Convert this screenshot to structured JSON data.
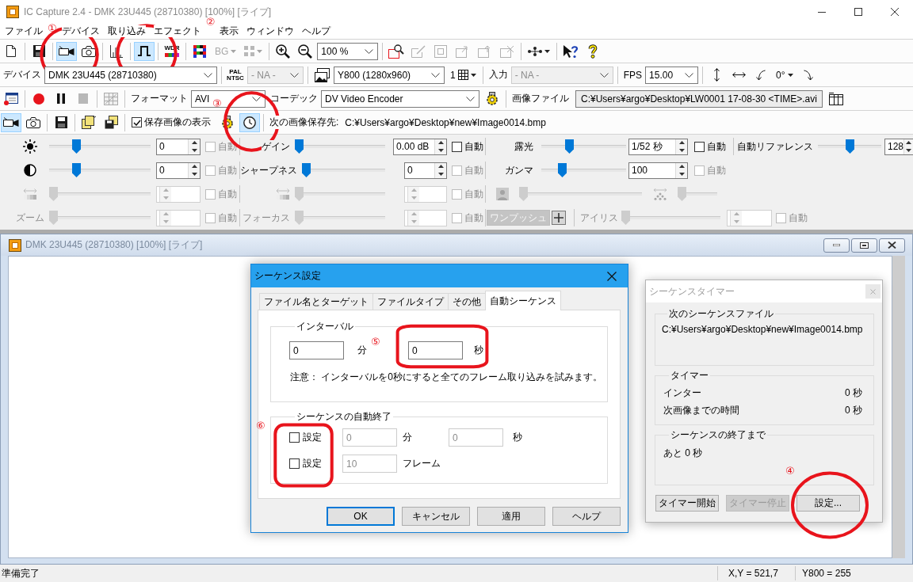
{
  "window": {
    "title": "IC Capture 2.4 - DMK 23U445 (28710380) [100%] [ライブ]"
  },
  "menu": [
    "ファイル",
    "デバイス",
    "取り込み",
    "エフェクト",
    "表示",
    "ウィンドウ",
    "ヘルプ"
  ],
  "toolbars": [
    [
      {
        "kind": "button",
        "selected": false,
        "disabled": false
      },
      {
        "kind": "separator"
      },
      {
        "kind": "button",
        "selected": false,
        "disabled": false
      },
      {
        "kind": "separator"
      },
      {
        "kind": "button",
        "selected": true,
        "disabled": false
      },
      {
        "kind": "button",
        "selected": false,
        "disabled": false
      },
      {
        "kind": "separator"
      },
      {
        "kind": "button",
        "selected": false,
        "disabled": false
      },
      {
        "kind": "separator"
      },
      {
        "kind": "button",
        "selected": true,
        "disabled": false
      },
      {
        "kind": "separator"
      },
      {
        "kind": "button",
        "text": "WDR",
        "selected": false,
        "disabled": false
      },
      {
        "kind": "separator"
      },
      {
        "kind": "button",
        "selected": false,
        "disabled": false
      },
      {
        "kind": "menu-button",
        "text": "BG",
        "disabled": true
      },
      {
        "kind": "menu-button",
        "disabled": true
      },
      {
        "kind": "separator"
      },
      {
        "kind": "button",
        "selected": false,
        "disabled": false
      },
      {
        "kind": "button",
        "selected": false,
        "disabled": false
      },
      {
        "kind": "combo",
        "value": "100 %",
        "disabled": false
      },
      {
        "kind": "separator"
      },
      {
        "kind": "button",
        "selected": false,
        "disabled": false
      },
      {
        "kind": "button",
        "selected": false,
        "disabled": true
      },
      {
        "kind": "button",
        "selected": false,
        "disabled": true
      },
      {
        "kind": "button",
        "selected": false,
        "disabled": true
      },
      {
        "kind": "button",
        "selected": false,
        "disabled": true
      },
      {
        "kind": "button",
        "selected": false,
        "disabled": true
      },
      {
        "kind": "separator"
      },
      {
        "kind": "menu-button",
        "disabled": false
      },
      {
        "kind": "separator"
      },
      {
        "kind": "button",
        "selected": false,
        "disabled": false
      },
      {
        "kind": "button",
        "selected": false,
        "disabled": false
      }
    ],
    [
      {
        "kind": "label",
        "text": "デバイス"
      },
      {
        "kind": "combo",
        "value": "DMK 23U445 (28710380)",
        "disabled": false
      },
      {
        "kind": "separator"
      },
      {
        "kind": "button",
        "text": "PAL NTSC",
        "selected": false,
        "disabled": false
      },
      {
        "kind": "combo",
        "value": "- NA -",
        "disabled": true
      },
      {
        "kind": "separator"
      },
      {
        "kind": "button",
        "selected": false,
        "disabled": false
      },
      {
        "kind": "combo",
        "value": "Y800 (1280x960)",
        "disabled": false
      },
      {
        "kind": "menu-button",
        "text": "1",
        "disabled": false
      },
      {
        "kind": "separator"
      },
      {
        "kind": "label",
        "text": "入力"
      },
      {
        "kind": "combo",
        "value": "- NA -",
        "disabled": true
      },
      {
        "kind": "separator"
      },
      {
        "kind": "label",
        "text": "FPS"
      },
      {
        "kind": "combo",
        "value": "15.00",
        "disabled": false
      },
      {
        "kind": "separator"
      },
      {
        "kind": "button",
        "selected": false,
        "disabled": false
      },
      {
        "kind": "button",
        "selected": false,
        "disabled": false
      },
      {
        "kind": "button",
        "selected": false,
        "disabled": false
      },
      {
        "kind": "menu-button",
        "text": "0°",
        "disabled": false
      },
      {
        "kind": "button",
        "selected": false,
        "disabled": false
      }
    ],
    [
      {
        "kind": "button",
        "selected": false,
        "disabled": false
      },
      {
        "kind": "separator"
      },
      {
        "kind": "button",
        "selected": false,
        "disabled": false
      },
      {
        "kind": "button",
        "selected": false,
        "disabled": false
      },
      {
        "kind": "button",
        "selected": false,
        "disabled": true
      },
      {
        "kind": "separator"
      },
      {
        "kind": "button",
        "selected": false,
        "disabled": true
      },
      {
        "kind": "separator"
      },
      {
        "kind": "label",
        "text": "フォーマット"
      },
      {
        "kind": "combo",
        "value": "AVI",
        "disabled": false
      },
      {
        "kind": "label",
        "text": "コーデック"
      },
      {
        "kind": "combo",
        "value": "DV Video Encoder",
        "disabled": false
      },
      {
        "kind": "button",
        "selected": false,
        "disabled": false
      },
      {
        "kind": "separator"
      },
      {
        "kind": "label",
        "text": "画像ファイル"
      },
      {
        "kind": "field",
        "value": "C:¥Users¥argo¥Desktop¥LW0001 17-08-30 <TIME>.avi"
      },
      {
        "kind": "button",
        "selected": false,
        "disabled": false
      }
    ],
    [
      {
        "kind": "button",
        "selected": true,
        "disabled": false
      },
      {
        "kind": "button",
        "selected": false,
        "disabled": false
      },
      {
        "kind": "separator"
      },
      {
        "kind": "button",
        "selected": false,
        "disabled": false
      },
      {
        "kind": "separator"
      },
      {
        "kind": "button",
        "selected": false,
        "disabled": false
      },
      {
        "kind": "button",
        "selected": false,
        "disabled": false
      },
      {
        "kind": "separator"
      },
      {
        "kind": "checkbox",
        "label": "保存画像の表示",
        "checked": true
      },
      {
        "kind": "button",
        "selected": false,
        "disabled": false
      },
      {
        "kind": "button",
        "selected": true,
        "disabled": false
      },
      {
        "kind": "separator"
      },
      {
        "kind": "label",
        "text": "次の画像保存先:"
      },
      {
        "kind": "text",
        "text": "C:¥Users¥argo¥Desktop¥new¥Image0014.bmp"
      }
    ]
  ],
  "properties": [
    [
      {
        "kind": "slider",
        "level": 0.25,
        "disabled": false,
        "value": "0",
        "auto": {
          "label": "自動",
          "checked": false,
          "disabled": true
        }
      },
      {
        "kind": "slider",
        "label": "ゲイン",
        "level": 0,
        "disabled": false,
        "value": "0.00 dB",
        "auto": {
          "label": "自動",
          "checked": false,
          "disabled": false
        }
      },
      {
        "kind": "slider",
        "label": "露光",
        "level": 0.31,
        "disabled": false,
        "value": "1/52 秒",
        "auto": {
          "label": "自動",
          "checked": false,
          "disabled": false
        }
      },
      {
        "kind": "slider",
        "label": "自動リファレンス",
        "level": 0.5,
        "disabled": false,
        "value": "128"
      }
    ],
    [
      {
        "kind": "slider",
        "level": 0.25,
        "disabled": false,
        "value": "0",
        "auto": {
          "label": "自動",
          "checked": false,
          "disabled": true
        }
      },
      {
        "kind": "slider",
        "label": "シャープネス",
        "level": 0,
        "disabled": false,
        "value": "0",
        "auto": {
          "label": "自動",
          "checked": false,
          "disabled": true
        }
      },
      {
        "kind": "slider",
        "label": "ガンマ",
        "level": 0.22,
        "disabled": false,
        "value": "100",
        "auto": {
          "label": "自動",
          "checked": false,
          "disabled": true
        }
      }
    ],
    [
      {
        "kind": "slider",
        "level": 0,
        "disabled": true,
        "auto": {
          "label": "自動",
          "checked": false,
          "disabled": true
        }
      },
      {
        "kind": "slider",
        "level": 0,
        "disabled": true,
        "auto": {
          "label": "自動",
          "checked": false,
          "disabled": true
        }
      },
      {
        "kind": "slider-only",
        "level": 0,
        "disabled": true
      },
      {
        "kind": "slider-only",
        "level": 0,
        "disabled": true
      }
    ],
    [
      {
        "kind": "slider",
        "label": "ズーム",
        "level": 0,
        "disabled": true,
        "auto": {
          "label": "自動",
          "checked": false,
          "disabled": true
        }
      },
      {
        "kind": "slider",
        "label": "フォーカス",
        "level": 0,
        "disabled": true,
        "auto": {
          "label": "自動",
          "checked": false,
          "disabled": true
        }
      },
      {
        "kind": "button",
        "label": "ワンプッシュ",
        "disabled": true
      },
      {
        "kind": "icon-button"
      },
      {
        "kind": "slider",
        "label": "アイリス",
        "level": 0,
        "disabled": true,
        "auto": {
          "label": "自動",
          "checked": false,
          "disabled": true
        }
      }
    ]
  ],
  "child_window": {
    "title": "DMK 23U445 (28710380) [100%] [ライブ]"
  },
  "sequence_dialog": {
    "title": "シーケンス設定",
    "tabs": [
      {
        "label": "ファイル名とターゲット",
        "selected": false
      },
      {
        "label": "ファイルタイプ",
        "selected": false
      },
      {
        "label": "その他",
        "selected": false
      },
      {
        "label": "自動シーケンス",
        "selected": true
      }
    ],
    "interval": {
      "title": "インターバル",
      "fields": [
        {
          "value": "0",
          "unit": "分"
        },
        {
          "value": "0",
          "unit": "秒"
        }
      ],
      "note": "注意： インターバルを0秒にすると全てのフレーム取り込みを試みます。"
    },
    "auto_end": {
      "title": "シーケンスの自動終了",
      "rows": [
        {
          "checkbox": {
            "label": "設定",
            "checked": false
          },
          "fields": [
            {
              "value": "0",
              "unit": "分",
              "disabled": true
            },
            {
              "value": "0",
              "unit": "秒",
              "disabled": true
            }
          ]
        },
        {
          "checkbox": {
            "label": "設定",
            "checked": false
          },
          "fields": [
            {
              "value": "10",
              "unit": "フレーム",
              "disabled": true
            }
          ]
        }
      ]
    },
    "buttons": [
      {
        "label": "OK",
        "default": true
      },
      {
        "label": "キャンセル",
        "default": false
      },
      {
        "label": "適用",
        "default": false
      },
      {
        "label": "ヘルプ",
        "default": false
      }
    ]
  },
  "timer_window": {
    "title": "シーケンスタイマー",
    "next_file": {
      "title": "次のシーケンスファイル",
      "path": "C:¥Users¥argo¥Desktop¥new¥Image0014.bmp"
    },
    "timer": {
      "title": "タイマー",
      "rows": [
        {
          "label": "インター",
          "value": "0 秒"
        },
        {
          "label": "次画像までの時間",
          "value": "0 秒"
        }
      ]
    },
    "until_end": {
      "title": "シーケンスの終了まで",
      "text": "あと 0 秒"
    },
    "buttons": [
      {
        "label": "タイマー開始",
        "disabled": false
      },
      {
        "label": "タイマー停止",
        "disabled": true
      },
      {
        "label": "設定...",
        "disabled": false
      }
    ]
  },
  "status_bar": {
    "text": "準備完了",
    "coordinates": "X,Y = 521,7",
    "pixel": "Y800 = 255"
  },
  "annotations": [
    {
      "number": "①",
      "kind": "circle"
    },
    {
      "number": "②",
      "kind": "circle"
    },
    {
      "number": "③",
      "kind": "circle"
    },
    {
      "number": "④",
      "kind": "circle"
    },
    {
      "number": "⑤",
      "kind": "box"
    },
    {
      "number": "⑥",
      "kind": "box"
    }
  ]
}
